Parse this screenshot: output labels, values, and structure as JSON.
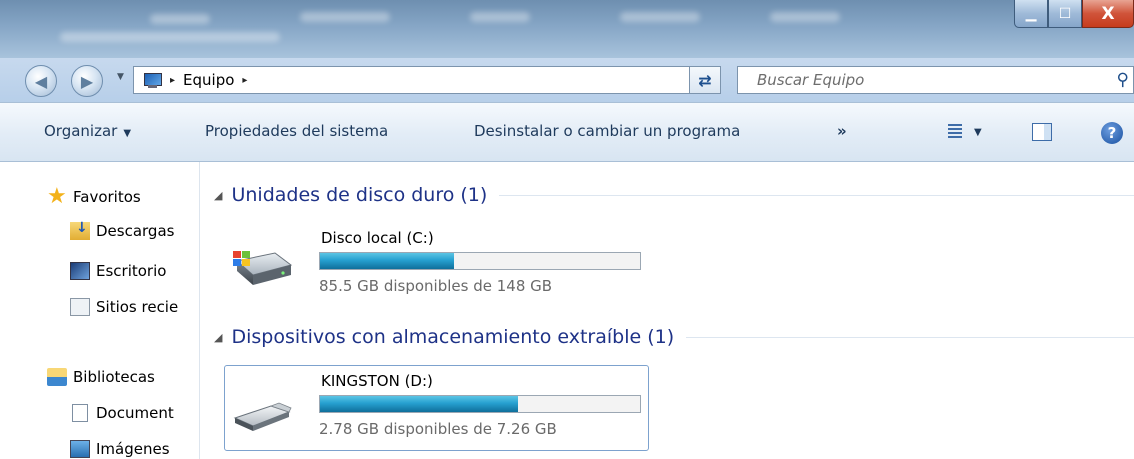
{
  "window": {
    "minimize_glyph": "▁",
    "maximize_glyph": "☐",
    "close_glyph": "X"
  },
  "address": {
    "back_glyph": "◀",
    "forward_glyph": "▶",
    "crumb_separator": "▸",
    "location": "Equipo",
    "refresh_glyph": "⇄",
    "search_placeholder": "Buscar Equipo",
    "search_glyph": "⚲"
  },
  "commands": {
    "organize": "Organizar",
    "organize_caret": "▼",
    "system_properties": "Propiedades del sistema",
    "uninstall": "Desinstalar o cambiar un programa",
    "more": "»",
    "view_caret": "▼",
    "help_glyph": "?"
  },
  "nav_pane": {
    "items": [
      {
        "label": "Favoritos",
        "icon": "star-icon"
      },
      {
        "label": "Descargas",
        "icon": "downloads-folder-icon"
      },
      {
        "label": "Escritorio",
        "icon": "desktop-icon"
      },
      {
        "label": "Sitios recie",
        "icon": "recent-places-icon"
      },
      {
        "label": "Bibliotecas",
        "icon": "libraries-icon"
      },
      {
        "label": "Document",
        "icon": "document-icon"
      },
      {
        "label": "Imágenes",
        "icon": "pictures-icon"
      }
    ]
  },
  "groups": {
    "hard_drives": {
      "title": "Unidades de disco duro (1)",
      "drive": {
        "name": "Disco local (C:)",
        "free_text": "85.5 GB disponibles de 148 GB",
        "used_fraction": 0.42
      }
    },
    "removable": {
      "title": "Dispositivos con almacenamiento extraíble (1)",
      "drive": {
        "name": "KINGSTON (D:)",
        "free_text": "2.78 GB disponibles de 7.26 GB",
        "used_fraction": 0.62
      }
    },
    "expand_glyph": "◢"
  },
  "colors": {
    "group_header": "#1e3287",
    "bar_fill": "#26a0d0",
    "close_button": "#c63b1d"
  }
}
